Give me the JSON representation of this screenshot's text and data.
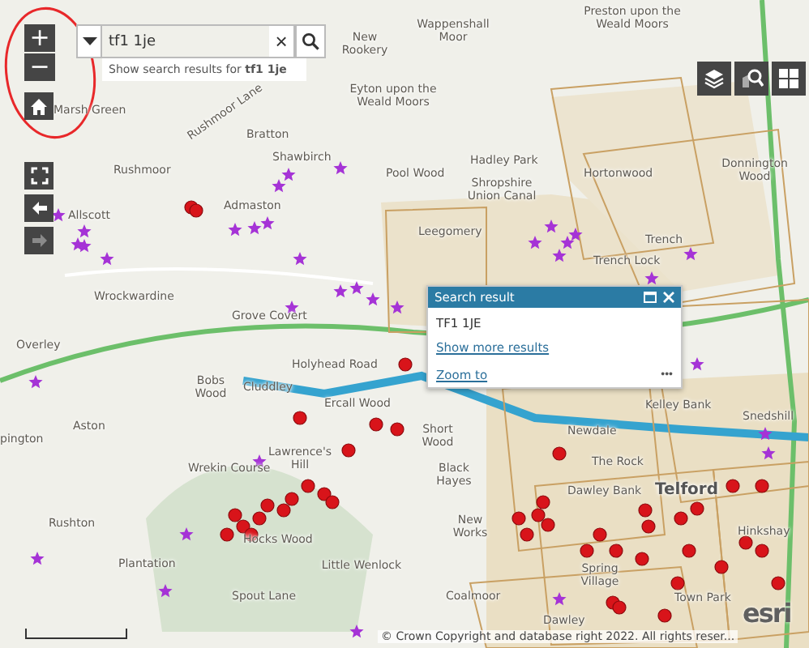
{
  "search": {
    "value": "tf1 1je",
    "suggestion": "Show search results for **tf1 1je**",
    "clear": "×"
  },
  "zoom_controls": [
    "+",
    "−"
  ],
  "nav_buttons": [
    {
      "kind": "home",
      "disabled": false
    },
    {
      "kind": "fullscreen",
      "disabled": false
    },
    {
      "kind": "back",
      "disabled": false
    },
    {
      "kind": "forward",
      "disabled": true
    }
  ],
  "toolbar": [
    {
      "kind": "layers"
    },
    {
      "kind": "region-search"
    },
    {
      "kind": "basemap"
    }
  ],
  "popup": {
    "title": "Search result",
    "result": "TF1 1JE",
    "link": "Show more results",
    "action": "Zoom to",
    "menu": "•••"
  },
  "map_labels": [
    "New Rookery",
    "Wappenshall Moor",
    "Preston upon the Weald Moors",
    "Eyton upon the Weald Moors",
    "Marsh Green",
    "Bratton",
    "Shawbirch",
    "Rushmoor",
    "Hadley Park",
    "Pool Wood",
    "Shropshire Union Canal",
    "Hortonwood",
    "Donnington Wood",
    "Allscott",
    "Admaston",
    "Leegomery",
    "Trench Lock",
    "Trench",
    "Wrockwardine",
    "Grove Covert",
    "Overley",
    "Holyhead Road",
    "Bobs Wood",
    "Cluddley",
    "Ercall Wood",
    "Kelley Bank",
    "Newdale",
    "The Rock",
    "Snedshill",
    "Aston",
    "Short Wood",
    "Lawrence's Hill",
    "Wrekin Course",
    "Black Hayes",
    "Dawley Bank",
    "Telford",
    "Rushton",
    "New Works",
    "Hinkshay",
    "Little Wenlock",
    "Coalmoor",
    "Town Park",
    "Dawley",
    "Hocks Wood",
    "Spring Village",
    "Spout Lane",
    "Plantation",
    "Rushmoor Lane",
    "pington"
  ],
  "attribution": "© Crown Copyright and database right 2022. All rights reser...",
  "logo": "esri"
}
